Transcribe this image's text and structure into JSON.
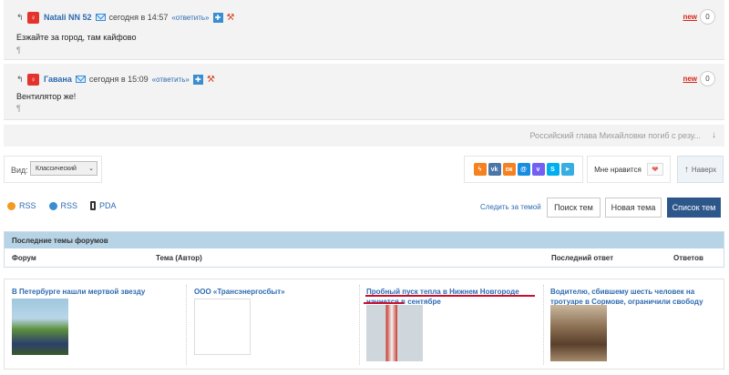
{
  "comments": [
    {
      "user": "Natali NN 52",
      "time": "сегодня в 14:57",
      "reply": "«ответить»",
      "text": "Езжайте за город, там кайфово",
      "para": "¶",
      "new": "new",
      "count": "0"
    },
    {
      "user": "Гавана",
      "time": "сегодня в 15:09",
      "reply": "«ответить»",
      "text": "Вентилятор же!",
      "para": "¶",
      "new": "new",
      "count": "0"
    }
  ],
  "next_news": {
    "text": "Российский глава Михайловки погиб с резу...",
    "arrow": "↓"
  },
  "view": {
    "label": "Вид:",
    "selected": "Классический"
  },
  "share": {
    "icons": [
      {
        "name": "lightning-icon",
        "glyph": "ϟ",
        "color": "#f5811f"
      },
      {
        "name": "vk-icon",
        "glyph": "vk",
        "color": "#4a76a8"
      },
      {
        "name": "odnoklassniki-icon",
        "glyph": "ок",
        "color": "#f58220"
      },
      {
        "name": "mail-icon",
        "glyph": "@",
        "color": "#168de2"
      },
      {
        "name": "viber-icon",
        "glyph": "v",
        "color": "#7360f2"
      },
      {
        "name": "skype-icon",
        "glyph": "S",
        "color": "#00aff0"
      },
      {
        "name": "telegram-icon",
        "glyph": "➤",
        "color": "#37aee2"
      }
    ]
  },
  "like": {
    "label": "Мне нравится",
    "heart": "❤"
  },
  "top_button": {
    "arrow": "↑",
    "label": "Наверх"
  },
  "feeds": {
    "rss1": "RSS",
    "rss2": "RSS",
    "pda": "PDA",
    "follow": "Следить за темой"
  },
  "buttons": {
    "search": "Поиск тем",
    "new_topic": "Новая тема",
    "list": "Список тем"
  },
  "forum": {
    "header": "Последние темы форумов",
    "columns": {
      "forum": "Форум",
      "topic": "Тема (Автор)",
      "last_reply": "Последний ответ",
      "replies": "Ответов"
    }
  },
  "news": [
    {
      "title": "В Петербурге нашли мертвой звезду «Дома-2»"
    },
    {
      "title": "ООО «Трансэнергосбыт»"
    },
    {
      "title": "Пробный пуск тепла в Нижнем Новгороде начнется в сентябре"
    },
    {
      "title": "Водителю, сбившему шесть человек на тротуаре в Сормове, ограничили свободу"
    }
  ],
  "colors": {
    "link": "#2e6ab1",
    "new": "#d7261b",
    "primary_button": "#2d578b",
    "forum_header": "#b7d4e6"
  }
}
